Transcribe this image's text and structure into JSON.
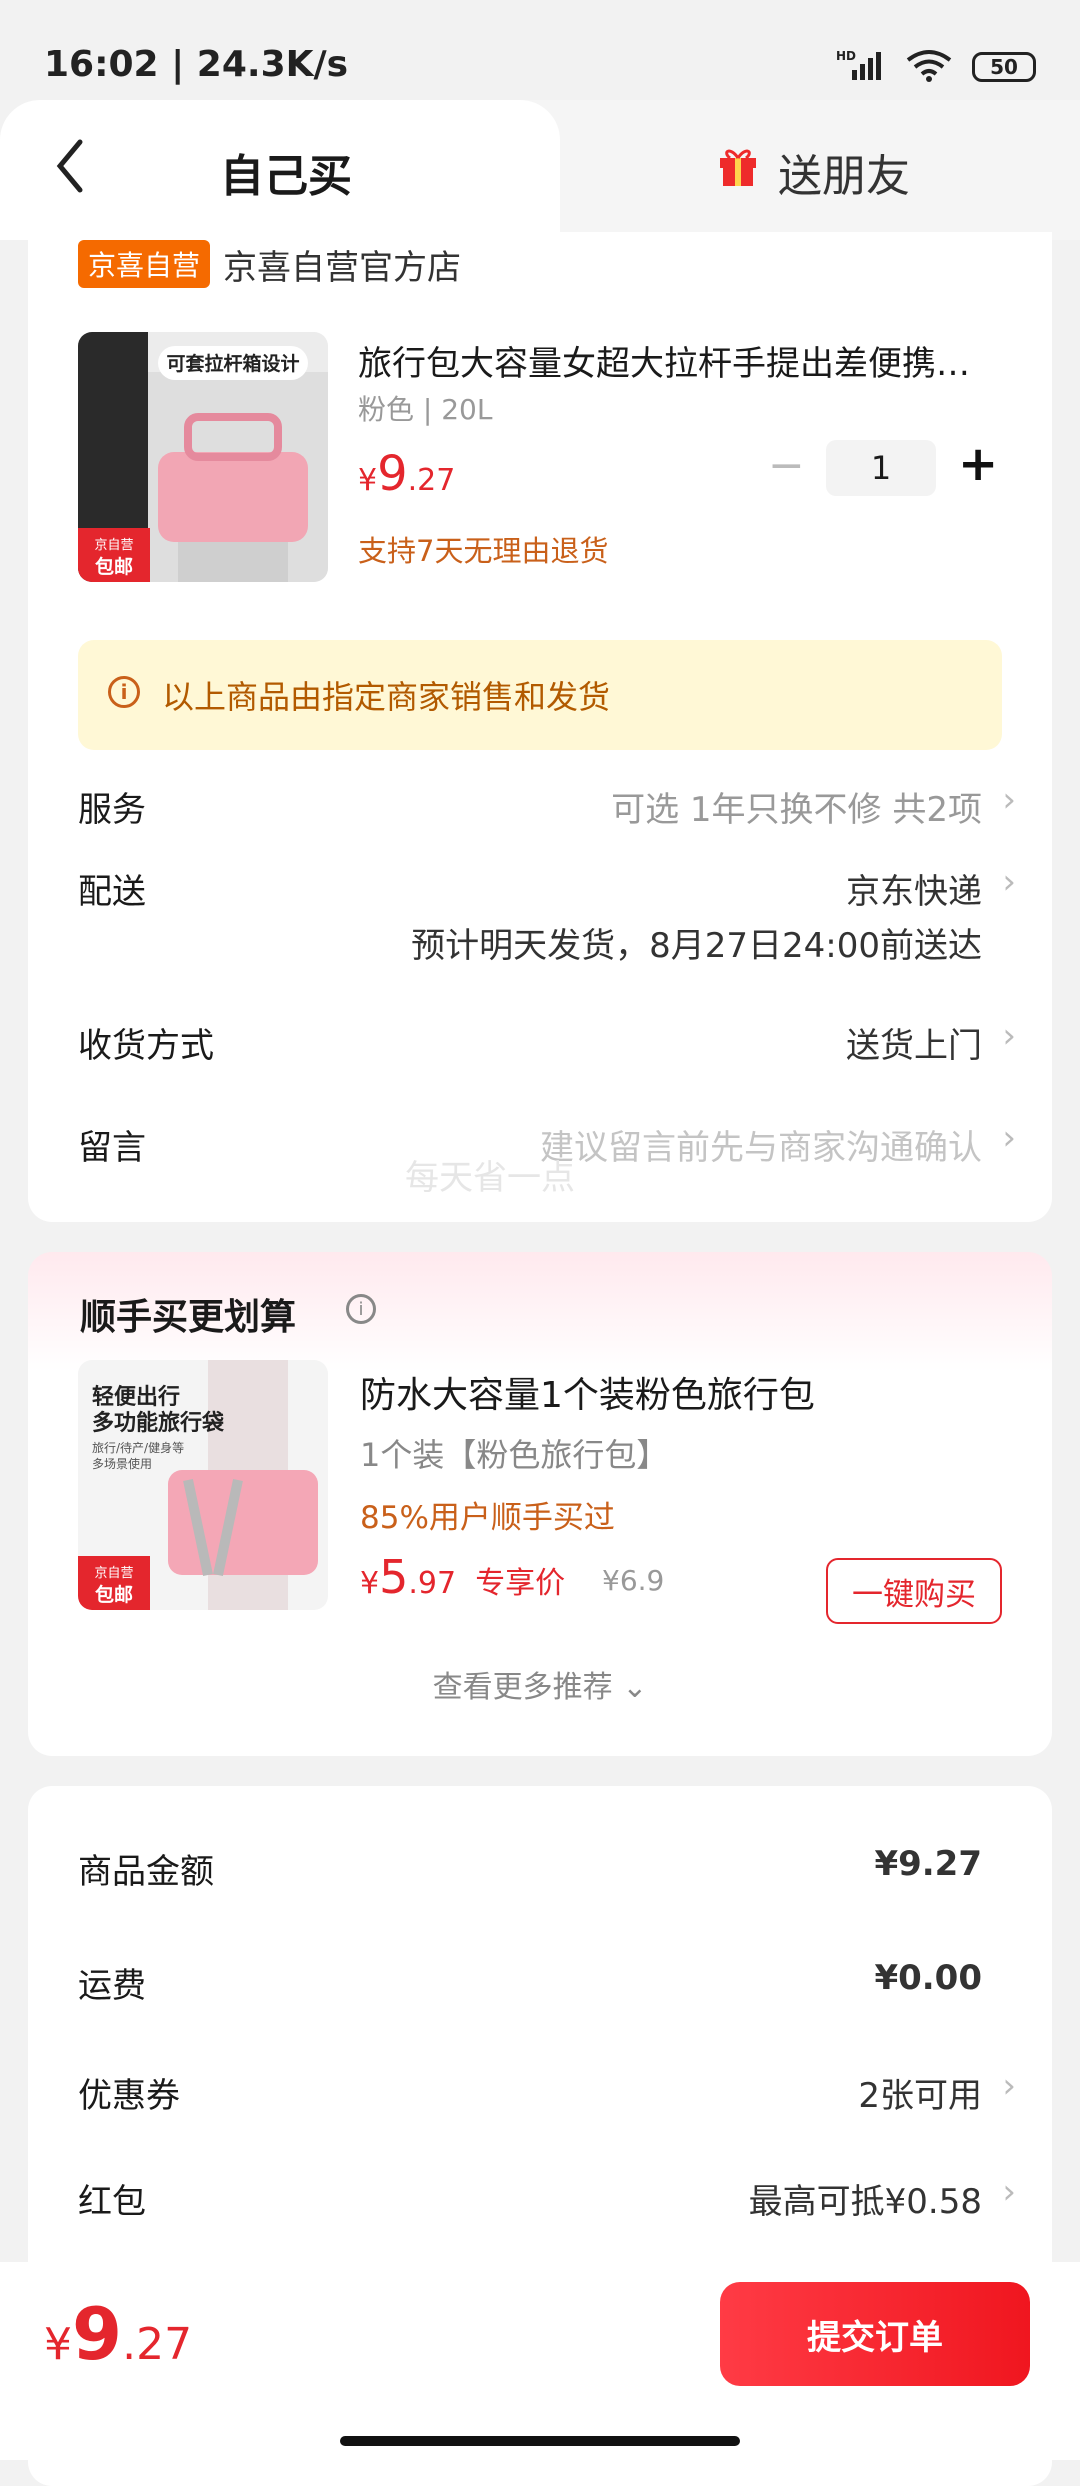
{
  "status_bar": {
    "time": "16:02 | 24.3K/s",
    "network": "HD",
    "battery": "50"
  },
  "tabs": {
    "self_buy": "自己买",
    "send_friend": "送朋友"
  },
  "store": {
    "badge": "京喜自营",
    "name": "京喜自营官方店"
  },
  "product": {
    "title": "旅行包大容量女超大拉杆手提出差便携…",
    "spec": "粉色 | 20L",
    "price_symbol": "¥",
    "price_int": "9",
    "price_dec": ".27",
    "return_policy": "支持7天无理由退货",
    "quantity": "1",
    "thumb_caption": "可套拉杆箱设计",
    "thumb_badge_1": "京自营",
    "thumb_badge_2": "包邮"
  },
  "notice": {
    "text": "以上商品由指定商家销售和发货"
  },
  "rows": {
    "service_label": "服务",
    "service_value": "可选 1年只换不修 共2项",
    "delivery_label": "配送",
    "delivery_value": "京东快递",
    "delivery_eta": "预计明天发货，8月27日24:00前送达",
    "receive_label": "收货方式",
    "receive_value": "送货上门",
    "message_label": "留言",
    "message_placeholder": "建议留言前先与商家沟通确认"
  },
  "watermark": "每天省一点",
  "addon": {
    "header": "顺手买更划算",
    "title": "防水大容量1个装粉色旅行包",
    "spec": "1个装【粉色旅行包】",
    "buyers": "85%用户顺手买过",
    "price_symbol": "¥",
    "price_int": "5",
    "price_dec": ".97",
    "price_tag": "专享价",
    "orig_price": "¥6.9",
    "buy_button": "一键购买",
    "more": "查看更多推荐",
    "thumb_caption_1": "轻便出行",
    "thumb_caption_2": "多功能旅行袋",
    "thumb_caption_3": "旅行/待产/健身等",
    "thumb_caption_4": "多场景使用",
    "thumb_badge_1": "京自营",
    "thumb_badge_2": "包邮"
  },
  "summary": {
    "goods_label": "商品金额",
    "goods_value": "¥9.27",
    "ship_label": "运费",
    "ship_value": "¥0.00",
    "coupon_label": "优惠券",
    "coupon_value": "2张可用",
    "redpack_label": "红包",
    "redpack_value": "最高可抵¥0.58"
  },
  "bottom": {
    "price_symbol": "¥",
    "price_int": "9",
    "price_dec": ".27",
    "submit": "提交订单"
  },
  "colors": {
    "accent_red": "#e4262d",
    "badge_orange": "#f56a00",
    "notice_bg": "#fff8d6"
  }
}
